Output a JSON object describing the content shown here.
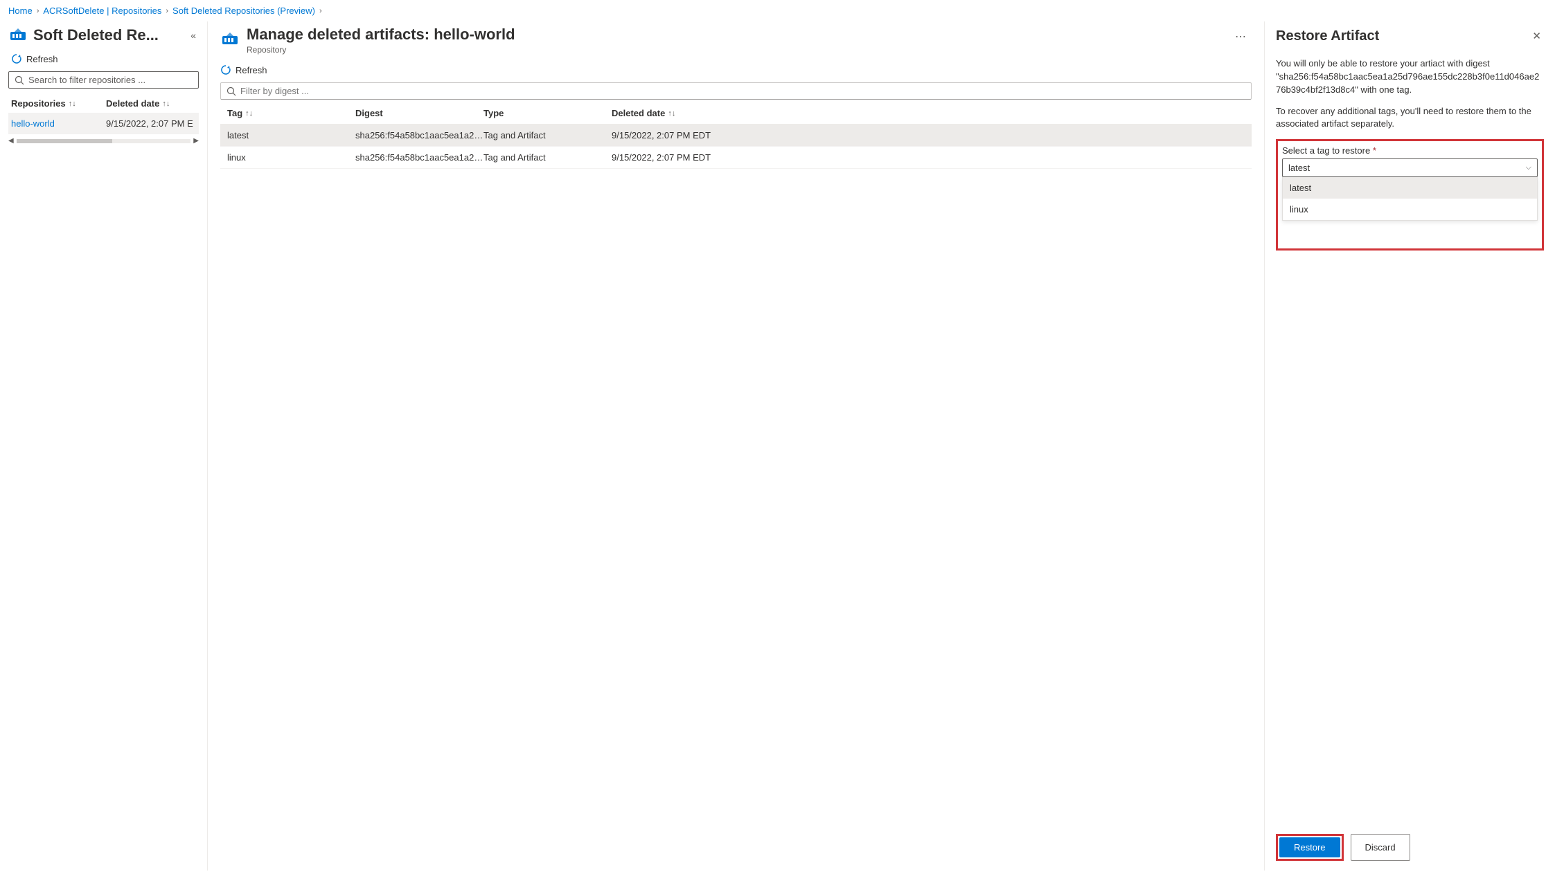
{
  "breadcrumb": {
    "home": "Home",
    "repo_link": "ACRSoftDelete | Repositories",
    "soft_deleted": "Soft Deleted Repositories (Preview)"
  },
  "sidebar": {
    "title": "Soft Deleted Re...",
    "refresh": "Refresh",
    "search_placeholder": "Search to filter repositories ...",
    "col_repo": "Repositories",
    "col_date": "Deleted date",
    "rows": [
      {
        "name": "hello-world",
        "date": "9/15/2022, 2:07 PM E"
      }
    ]
  },
  "main": {
    "title": "Manage deleted artifacts: hello-world",
    "subtitle": "Repository",
    "refresh": "Refresh",
    "filter_placeholder": "Filter by digest ...",
    "headers": {
      "tag": "Tag",
      "digest": "Digest",
      "type": "Type",
      "deleted": "Deleted date"
    },
    "rows": [
      {
        "tag": "latest",
        "digest": "sha256:f54a58bc1aac5ea1a25...",
        "type": "Tag and Artifact",
        "deleted": "9/15/2022, 2:07 PM EDT"
      },
      {
        "tag": "linux",
        "digest": "sha256:f54a58bc1aac5ea1a25...",
        "type": "Tag and Artifact",
        "deleted": "9/15/2022, 2:07 PM EDT"
      }
    ]
  },
  "panel": {
    "title": "Restore Artifact",
    "text1": "You will only be able to restore your artiact with digest \"sha256:f54a58bc1aac5ea1a25d796ae155dc228b3f0e11d046ae276b39c4bf2f13d8c4\" with one tag.",
    "text2": "To recover any additional tags, you'll need to restore them to the associated artifact separately.",
    "select_label": "Select a tag to restore",
    "selected": "latest",
    "options": [
      "latest",
      "linux"
    ],
    "restore": "Restore",
    "discard": "Discard"
  }
}
